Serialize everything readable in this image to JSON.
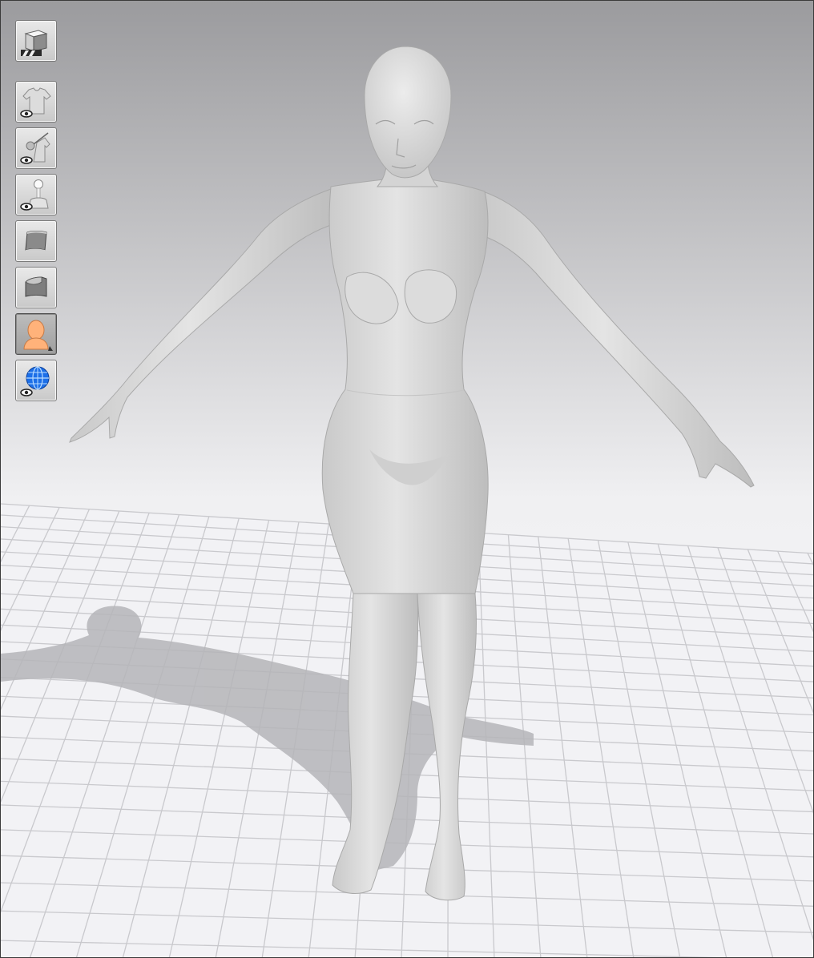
{
  "viewport": {
    "name": "3d-viewport",
    "background_top": "#9b9b9e",
    "background_bottom": "#fbfbfd",
    "floor_color": "#f2f2f5",
    "grid_color": "#c9c9cd",
    "figure_color": "#d9d9d9",
    "shadow_color": "#b5b5b8"
  },
  "toolbar": {
    "items": [
      {
        "name": "view-mode-cube-icon",
        "active": false
      },
      {
        "name": "show-garments-icon",
        "active": false
      },
      {
        "name": "show-pins-icon",
        "active": false
      },
      {
        "name": "show-avatar-icon",
        "active": false
      },
      {
        "name": "fabric-front-icon",
        "active": false
      },
      {
        "name": "fabric-back-icon",
        "active": false
      },
      {
        "name": "avatar-skin-icon",
        "active": true
      },
      {
        "name": "show-environment-globe-icon",
        "active": false
      }
    ]
  }
}
